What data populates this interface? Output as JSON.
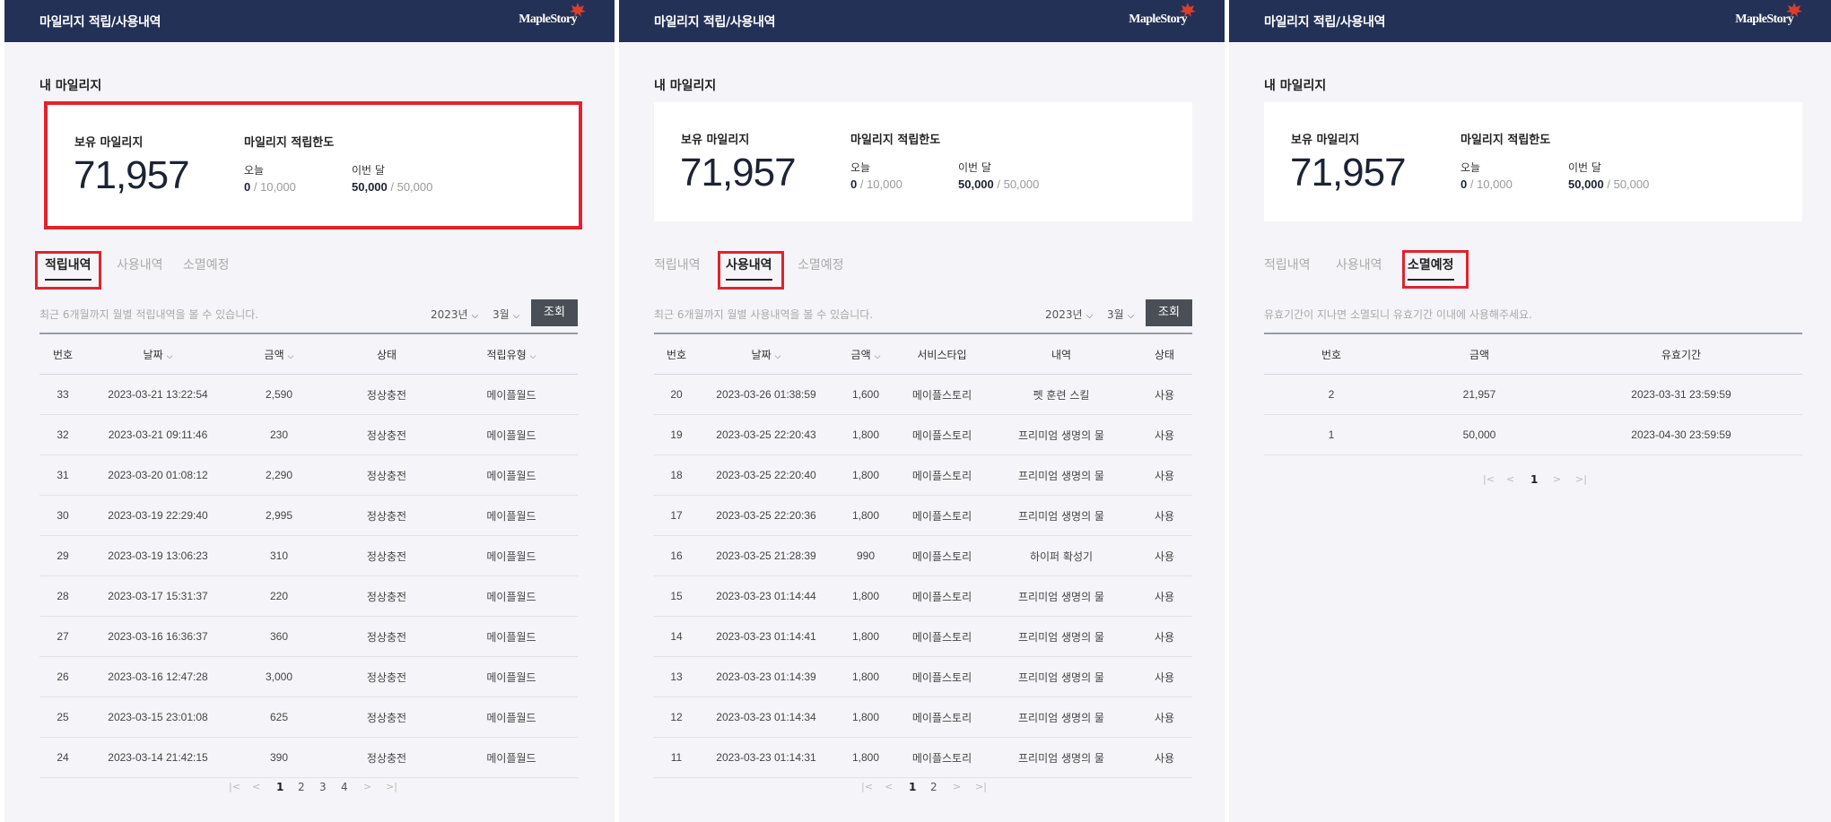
{
  "header": {
    "title": "마일리지 적립/사용내역",
    "logo": "MapleStory"
  },
  "mileage": {
    "section_title": "내 마일리지",
    "owned_label": "보유 마일리지",
    "owned_value": "71,957",
    "limit_label": "마일리지 적립한도",
    "today_label": "오늘",
    "today_value": "0",
    "today_limit": " / 10,000",
    "month_label": "이번 달",
    "month_value": "50,000",
    "month_limit": " / 50,000"
  },
  "tabs": {
    "earn": "적립내역",
    "use": "사용내역",
    "expire": "소멸예정"
  },
  "filters": {
    "year": "2023년",
    "month": "3월",
    "search_label": "조회"
  },
  "pager_icons": {
    "first": "first-page-icon",
    "prev": "prev-page-icon",
    "next": "next-page-icon",
    "last": "last-page-icon"
  },
  "earn": {
    "notice": "최근 6개월까지 월별 적립내역을 볼 수 있습니다.",
    "headers": [
      "번호",
      "날짜",
      "금액",
      "상태",
      "적립유형"
    ],
    "rows": [
      [
        "33",
        "2023-03-21 13:22:54",
        "2,590",
        "정상충전",
        "메이플월드"
      ],
      [
        "32",
        "2023-03-21 09:11:46",
        "230",
        "정상충전",
        "메이플월드"
      ],
      [
        "31",
        "2023-03-20 01:08:12",
        "2,290",
        "정상충전",
        "메이플월드"
      ],
      [
        "30",
        "2023-03-19 22:29:40",
        "2,995",
        "정상충전",
        "메이플월드"
      ],
      [
        "29",
        "2023-03-19 13:06:23",
        "310",
        "정상충전",
        "메이플월드"
      ],
      [
        "28",
        "2023-03-17 15:31:37",
        "220",
        "정상충전",
        "메이플월드"
      ],
      [
        "27",
        "2023-03-16 16:36:37",
        "360",
        "정상충전",
        "메이플월드"
      ],
      [
        "26",
        "2023-03-16 12:47:28",
        "3,000",
        "정상충전",
        "메이플월드"
      ],
      [
        "25",
        "2023-03-15 23:01:08",
        "625",
        "정상충전",
        "메이플월드"
      ],
      [
        "24",
        "2023-03-14 21:42:15",
        "390",
        "정상충전",
        "메이플월드"
      ]
    ],
    "pages": [
      "1",
      "2",
      "3",
      "4"
    ],
    "current_page": "1"
  },
  "use": {
    "notice": "최근 6개월까지 월별 사용내역을 볼 수 있습니다.",
    "headers": [
      "번호",
      "날짜",
      "금액",
      "서비스타입",
      "내역",
      "상태"
    ],
    "rows": [
      [
        "20",
        "2023-03-26 01:38:59",
        "1,600",
        "메이플스토리",
        "펫 훈련 스킬",
        "사용"
      ],
      [
        "19",
        "2023-03-25 22:20:43",
        "1,800",
        "메이플스토리",
        "프리미엄 생명의 물",
        "사용"
      ],
      [
        "18",
        "2023-03-25 22:20:40",
        "1,800",
        "메이플스토리",
        "프리미엄 생명의 물",
        "사용"
      ],
      [
        "17",
        "2023-03-25 22:20:36",
        "1,800",
        "메이플스토리",
        "프리미엄 생명의 물",
        "사용"
      ],
      [
        "16",
        "2023-03-25 21:28:39",
        "990",
        "메이플스토리",
        "하이퍼 확성기",
        "사용"
      ],
      [
        "15",
        "2023-03-23 01:14:44",
        "1,800",
        "메이플스토리",
        "프리미엄 생명의 물",
        "사용"
      ],
      [
        "14",
        "2023-03-23 01:14:41",
        "1,800",
        "메이플스토리",
        "프리미엄 생명의 물",
        "사용"
      ],
      [
        "13",
        "2023-03-23 01:14:39",
        "1,800",
        "메이플스토리",
        "프리미엄 생명의 물",
        "사용"
      ],
      [
        "12",
        "2023-03-23 01:14:34",
        "1,800",
        "메이플스토리",
        "프리미엄 생명의 물",
        "사용"
      ],
      [
        "11",
        "2023-03-23 01:14:31",
        "1,800",
        "메이플스토리",
        "프리미엄 생명의 물",
        "사용"
      ]
    ],
    "pages": [
      "1",
      "2"
    ],
    "current_page": "1"
  },
  "expire": {
    "notice": "유효기간이 지나면 소멸되니 유효기간 이내에 사용해주세요.",
    "headers": [
      "번호",
      "금액",
      "유효기간"
    ],
    "rows": [
      [
        "2",
        "21,957",
        "2023-03-31 23:59:59"
      ],
      [
        "1",
        "50,000",
        "2023-04-30 23:59:59"
      ]
    ],
    "pages": [
      "1"
    ],
    "current_page": "1"
  }
}
